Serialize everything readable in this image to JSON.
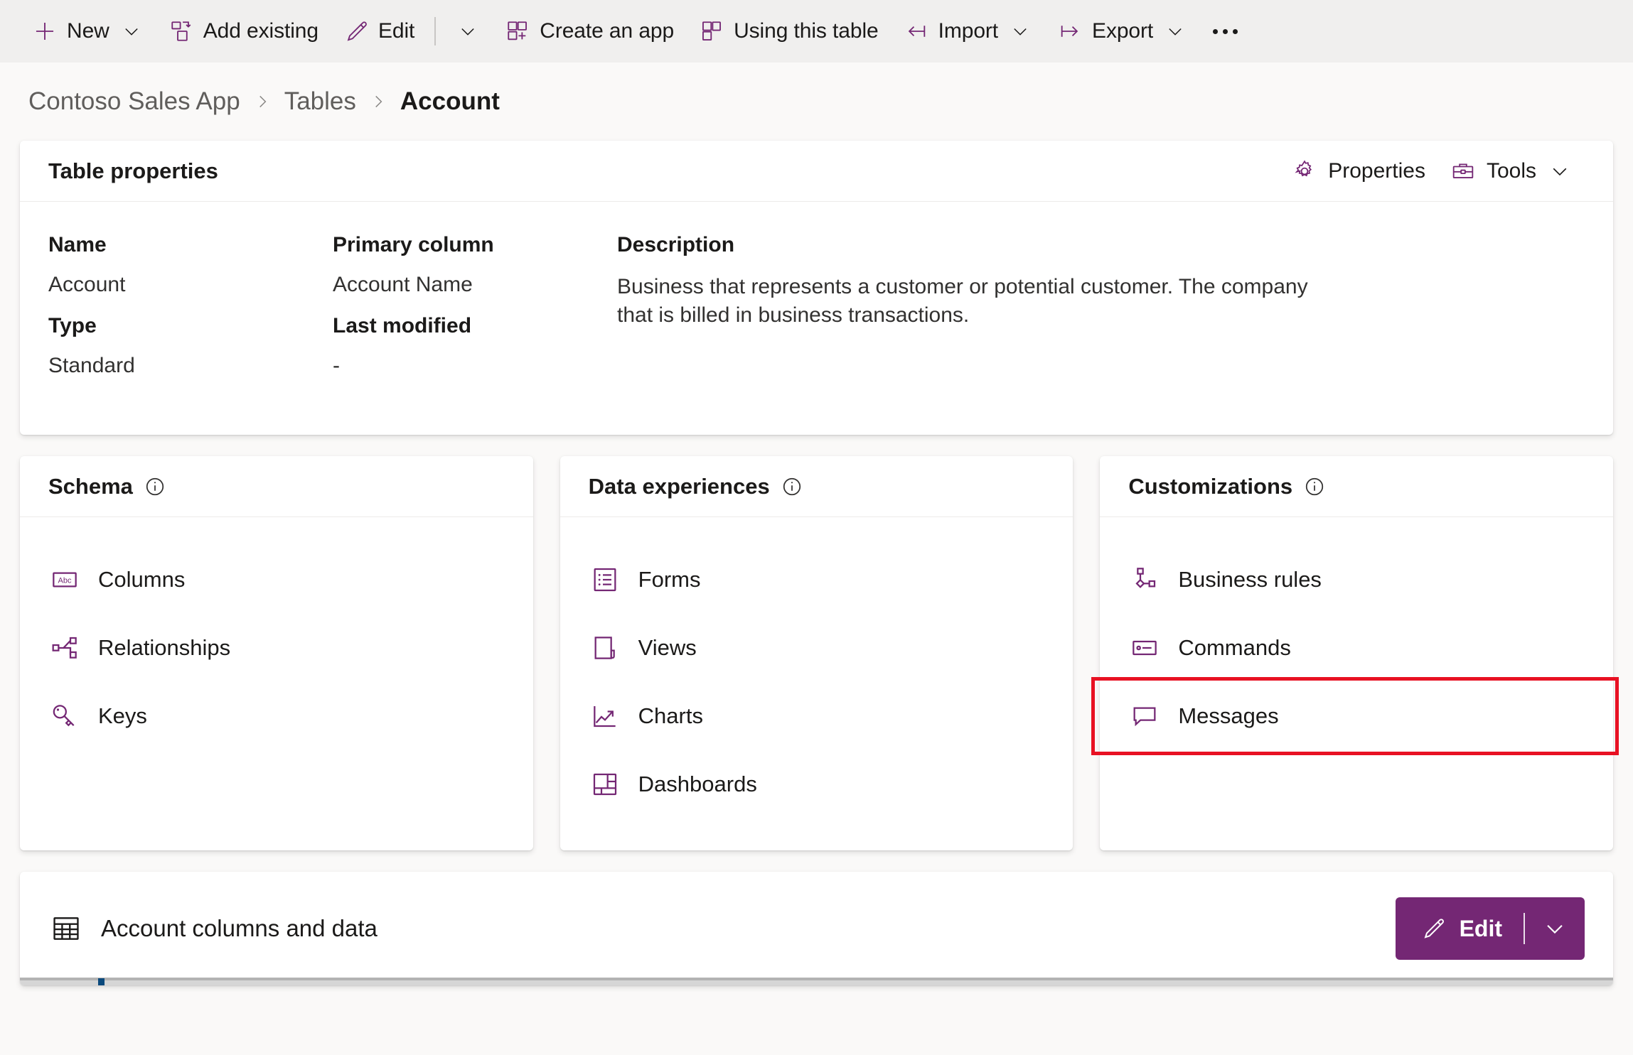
{
  "accent": "#742774",
  "highlight_color": "#E81123",
  "commandbar": {
    "items": [
      {
        "label": "New",
        "icon": "plus-icon",
        "has_chevron": true
      },
      {
        "label": "Add existing",
        "icon": "add-existing-icon",
        "has_chevron": false
      },
      {
        "label": "Edit",
        "icon": "pencil-icon",
        "has_chevron": true,
        "split": true
      },
      {
        "label": "Create an app",
        "icon": "create-app-icon",
        "has_chevron": false
      },
      {
        "label": "Using this table",
        "icon": "using-table-icon",
        "has_chevron": false
      },
      {
        "label": "Import",
        "icon": "import-icon",
        "has_chevron": true
      },
      {
        "label": "Export",
        "icon": "export-icon",
        "has_chevron": true
      }
    ],
    "overflow_label": "More commands"
  },
  "breadcrumb": {
    "items": [
      "Contoso Sales App",
      "Tables"
    ],
    "current": "Account",
    "separator": "›"
  },
  "table_properties": {
    "title": "Table properties",
    "actions": [
      {
        "label": "Properties",
        "icon": "gear-icon",
        "has_chevron": false
      },
      {
        "label": "Tools",
        "icon": "toolbox-icon",
        "has_chevron": true
      }
    ],
    "fields": {
      "name_label": "Name",
      "name_value": "Account",
      "type_label": "Type",
      "type_value": "Standard",
      "primary_column_label": "Primary column",
      "primary_column_value": "Account Name",
      "last_modified_label": "Last modified",
      "last_modified_value": "-",
      "description_label": "Description",
      "description_value": "Business that represents a customer or potential customer. The company that is billed in business transactions."
    }
  },
  "cards": [
    {
      "title": "Schema",
      "info": "info-icon",
      "items": [
        {
          "label": "Columns",
          "icon": "abc-columns-icon",
          "highlighted": false
        },
        {
          "label": "Relationships",
          "icon": "relationships-icon",
          "highlighted": false
        },
        {
          "label": "Keys",
          "icon": "key-icon",
          "highlighted": false
        }
      ]
    },
    {
      "title": "Data experiences",
      "info": "info-icon",
      "items": [
        {
          "label": "Forms",
          "icon": "form-icon",
          "highlighted": false
        },
        {
          "label": "Views",
          "icon": "view-icon",
          "highlighted": false
        },
        {
          "label": "Charts",
          "icon": "chart-icon",
          "highlighted": false
        },
        {
          "label": "Dashboards",
          "icon": "dashboard-icon",
          "highlighted": false
        }
      ]
    },
    {
      "title": "Customizations",
      "info": "info-icon",
      "items": [
        {
          "label": "Business rules",
          "icon": "business-rules-icon",
          "highlighted": false
        },
        {
          "label": "Commands",
          "icon": "commands-icon",
          "highlighted": false
        },
        {
          "label": "Messages",
          "icon": "message-bubble-icon",
          "highlighted": true
        }
      ]
    }
  ],
  "bottom": {
    "title": "Account columns and data",
    "icon": "grid-table-icon",
    "edit_label": "Edit",
    "edit_icon": "pencil-icon",
    "edit_chevron": "chevron-down-icon"
  }
}
